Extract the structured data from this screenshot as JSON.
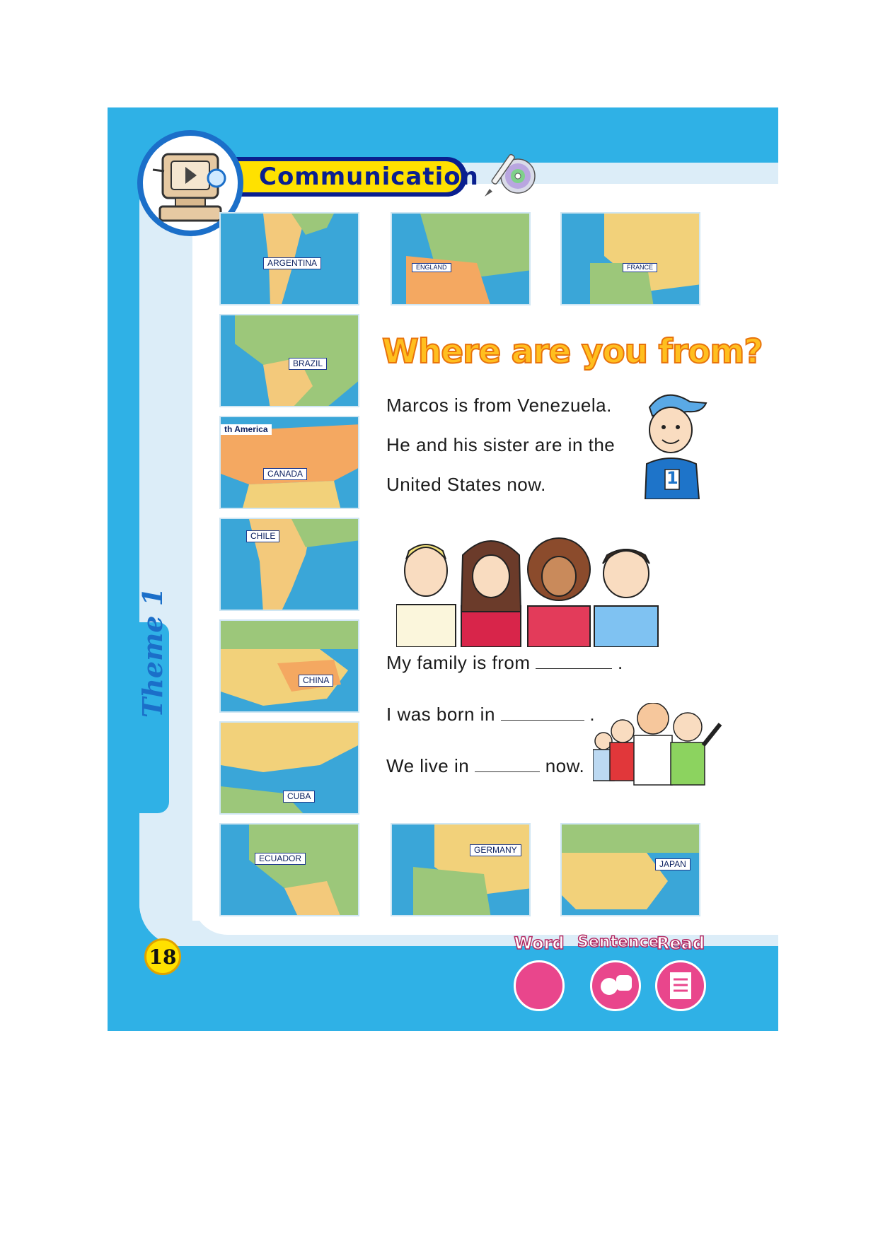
{
  "header": {
    "title": "Communication",
    "theme": "Theme 1",
    "page_number": "18"
  },
  "maps": [
    {
      "id": "argentina",
      "label": "ARGENTINA"
    },
    {
      "id": "england",
      "label": "ENGLAND"
    },
    {
      "id": "france",
      "label": "FRANCE"
    },
    {
      "id": "brazil",
      "label": "BRAZIL"
    },
    {
      "id": "canada",
      "label": "CANADA",
      "region_label": "th America"
    },
    {
      "id": "chile",
      "label": "CHILE"
    },
    {
      "id": "china",
      "label": "CHINA"
    },
    {
      "id": "cuba",
      "label": "CUBA"
    },
    {
      "id": "ecuador",
      "label": "ECUADOR"
    },
    {
      "id": "germany",
      "label": "GERMANY"
    },
    {
      "id": "japan",
      "label": "JAPAN"
    }
  ],
  "lesson": {
    "heading": "Where are you from?",
    "intro_lines": [
      "Marcos is from Venezuela.",
      "He and his sister are in the",
      "United States now."
    ],
    "shirt_number": "1",
    "fill_lines": [
      {
        "before": "My family is from",
        "after": "."
      },
      {
        "before": "I was born in",
        "after": "."
      },
      {
        "before": "We live in",
        "after": "now."
      }
    ]
  },
  "footer_buttons": [
    {
      "id": "word",
      "label": "Word"
    },
    {
      "id": "sentence",
      "label": "Sentence"
    },
    {
      "id": "read",
      "label": "Read"
    }
  ],
  "colors": {
    "frame": "#2fb1e6",
    "banner": "#ffe100",
    "heading": "#ffbf1f",
    "button": "#e9468c"
  }
}
